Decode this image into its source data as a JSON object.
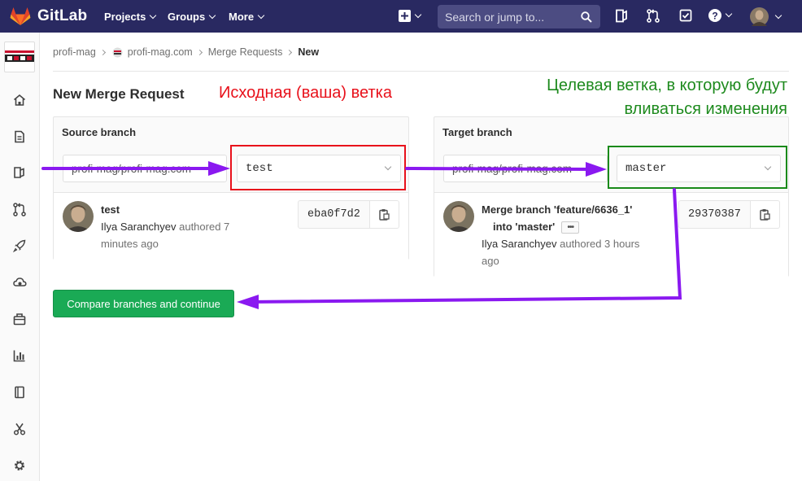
{
  "navbar": {
    "brand": "GitLab",
    "items": [
      {
        "label": "Projects"
      },
      {
        "label": "Groups"
      },
      {
        "label": "More"
      }
    ],
    "search_placeholder": "Search or jump to...",
    "bg_color": "#292961"
  },
  "sidebar": {
    "icons": [
      "home-icon",
      "issues-icon",
      "snippet-icon",
      "merge-request-icon",
      "rocket-icon",
      "cloud-icon",
      "package-icon",
      "chart-icon",
      "wiki-icon",
      "scissors-icon",
      "settings-icon"
    ]
  },
  "breadcrumb": {
    "items": [
      "profi-mag",
      "profi-mag.com",
      "Merge Requests"
    ],
    "current": "New"
  },
  "page": {
    "title": "New Merge Request"
  },
  "annotations": {
    "source_note": "Исходная (ваша) ветка",
    "target_note_line1": "Целевая ветка, в которую будут",
    "target_note_line2": "вливаться изменения",
    "red": "#e8111b",
    "green": "#1d8a1d",
    "arrow_color": "#8a19f0"
  },
  "source": {
    "heading": "Source branch",
    "project": "profi-mag/profi-mag.com",
    "branch": "test",
    "commit": {
      "title": "test",
      "author": "Ilya Saranchyev",
      "meta_line1_suffix": " authored 7",
      "meta_line2": "minutes ago",
      "sha": "eba0f7d2"
    }
  },
  "target": {
    "heading": "Target branch",
    "project": "profi-mag/profi-mag.com",
    "branch": "master",
    "commit": {
      "title_line1": "Merge branch 'feature/6636_1'",
      "title_line2": "into 'master'",
      "ellipsis": "•••",
      "author": "Ilya Saranchyev",
      "meta_suffix": " authored 3 hours",
      "meta_line2": "ago",
      "sha": "29370387"
    }
  },
  "actions": {
    "compare_label": "Compare branches and continue",
    "button_color": "#1aaa55"
  }
}
